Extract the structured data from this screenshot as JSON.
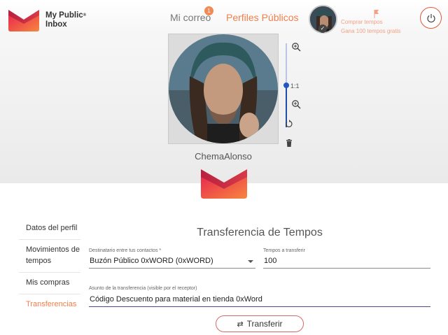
{
  "header": {
    "logo_line1": "My Public",
    "logo_reg": "®",
    "logo_line2": "Inbox",
    "nav_mail": "Mi correo",
    "mail_badge": "1",
    "nav_profiles": "Perfiles Públicos",
    "buy_link": "Comprar tempos",
    "earn_link": "Gana 100 tempos gratis",
    "avatar_check": "✓"
  },
  "photo_editor": {
    "zoom_ratio": "1:1",
    "zoom_level_fraction": 0.5,
    "username": "ChemaAlonso"
  },
  "side_menu": [
    {
      "label": "Datos del perfil",
      "active": false
    },
    {
      "label": "Movimientos de tempos",
      "active": false
    },
    {
      "label": "Mis compras",
      "active": false
    },
    {
      "label": "Transferencias",
      "active": true
    }
  ],
  "form": {
    "title": "Transferencia de Tempos",
    "recipient_label": "Destinatario entre tus contactos *",
    "recipient_value": "Buzón Público 0xWORD (0xWORD)",
    "amount_label": "Tempos a transferir",
    "amount_value": "100",
    "subject_label": "Asunto de la transferencia (visible por el receptor)",
    "subject_value": "Código Descuento para material en tienda 0xWord",
    "submit_label": "Transferir"
  },
  "colors": {
    "accent": "#f07f4c",
    "brand_gradient_start": "#e8244f",
    "brand_gradient_end": "#f7863f",
    "power": "#e0583a"
  },
  "icons": [
    "logo-mark",
    "power-icon",
    "zoom-in-icon",
    "zoom-out-icon",
    "rotate-icon",
    "trash-icon",
    "flag-icon",
    "check-icon",
    "transfer-icon",
    "dropdown-arrow-icon"
  ]
}
